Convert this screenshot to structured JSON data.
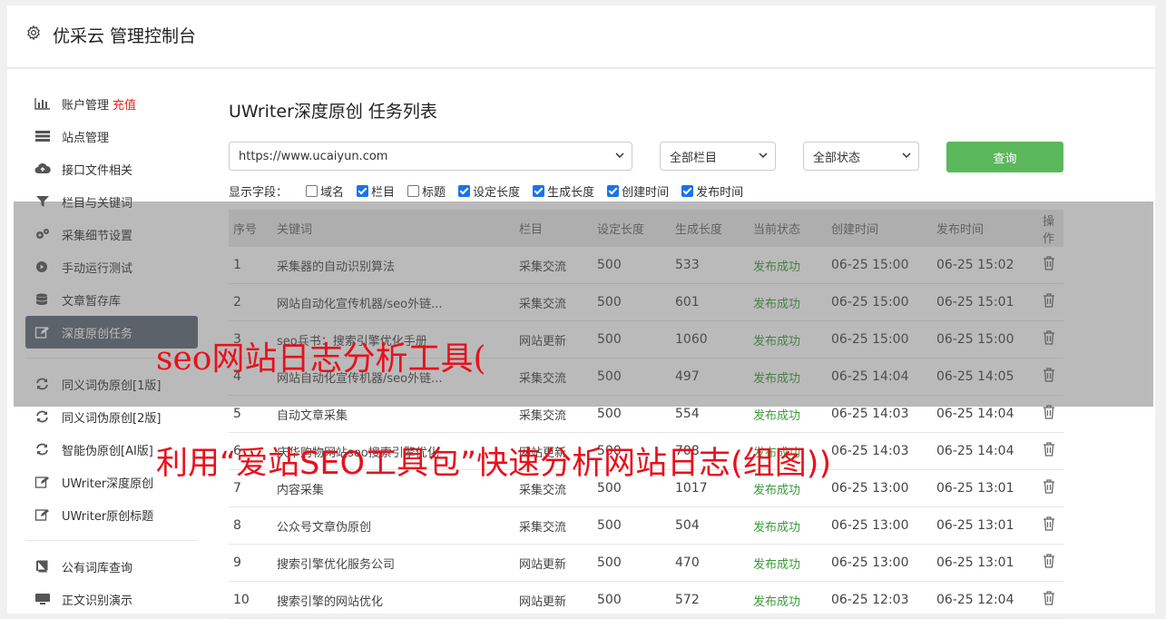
{
  "header": {
    "title": "优采云 管理控制台"
  },
  "sidebar": {
    "items": [
      {
        "label": "账户管理",
        "extra": "充值",
        "icon": "bar-chart-icon"
      },
      {
        "label": "站点管理",
        "icon": "server-icon"
      },
      {
        "label": "接口文件相关",
        "icon": "cloud-upload-icon"
      },
      {
        "label": "栏目与关键词",
        "icon": "filter-icon"
      },
      {
        "label": "采集细节设置",
        "icon": "cogs-icon"
      },
      {
        "label": "手动运行测试",
        "icon": "play-circle-icon"
      },
      {
        "label": "文章暂存库",
        "icon": "database-icon"
      },
      {
        "label": "深度原创任务",
        "icon": "edit-icon"
      },
      {
        "label": "同义词伪原创[1版]",
        "icon": "refresh-icon"
      },
      {
        "label": "同义词伪原创[2版]",
        "icon": "refresh-icon"
      },
      {
        "label": "智能伪原创[AI版]",
        "icon": "refresh-icon"
      },
      {
        "label": "UWriter深度原创",
        "icon": "edit-icon"
      },
      {
        "label": "UWriter原创标题",
        "icon": "edit-icon"
      },
      {
        "label": "公有词库查询",
        "icon": "book-icon"
      },
      {
        "label": "正文识别演示",
        "icon": "monitor-icon"
      }
    ]
  },
  "main": {
    "title": "UWriter深度原创 任务列表",
    "site_select": "https://www.ucaiyun.com",
    "column_select": "全部栏目",
    "status_select": "全部状态",
    "query_label": "查询",
    "fields_label": "显示字段：",
    "fields": [
      {
        "label": "域名",
        "checked": false
      },
      {
        "label": "栏目",
        "checked": true
      },
      {
        "label": "标题",
        "checked": false
      },
      {
        "label": "设定长度",
        "checked": true
      },
      {
        "label": "生成长度",
        "checked": true
      },
      {
        "label": "创建时间",
        "checked": true
      },
      {
        "label": "发布时间",
        "checked": true
      }
    ],
    "table": {
      "headers": [
        "序号",
        "关键词",
        "栏目",
        "设定长度",
        "生成长度",
        "当前状态",
        "创建时间",
        "发布时间",
        "操作"
      ],
      "rows": [
        [
          "1",
          "采集器的自动识别算法",
          "采集交流",
          "500",
          "533",
          "发布成功",
          "06-25 15:00",
          "06-25 15:02"
        ],
        [
          "2",
          "网站自动化宣传机器/seo外链...",
          "采集交流",
          "500",
          "601",
          "发布成功",
          "06-25 15:00",
          "06-25 15:01"
        ],
        [
          "3",
          "seo兵书：搜索引擎优化手册",
          "网站更新",
          "500",
          "1060",
          "发布成功",
          "06-25 15:00",
          "06-25 15:00"
        ],
        [
          "4",
          "网站自动化宣传机器/seo外链...",
          "采集交流",
          "500",
          "497",
          "发布成功",
          "06-25 14:04",
          "06-25 14:05"
        ],
        [
          "5",
          "自动文章采集",
          "采集交流",
          "500",
          "554",
          "发布成功",
          "06-25 14:03",
          "06-25 14:04"
        ],
        [
          "6",
          "庆华购物网站seo搜索引擎优化",
          "网站更新",
          "500",
          "708",
          "发布成功",
          "06-25 14:03",
          "06-25 14:04"
        ],
        [
          "7",
          "内容采集",
          "采集交流",
          "500",
          "1017",
          "发布成功",
          "06-25 13:00",
          "06-25 13:01"
        ],
        [
          "8",
          "公众号文章伪原创",
          "采集交流",
          "500",
          "504",
          "发布成功",
          "06-25 13:00",
          "06-25 13:01"
        ],
        [
          "9",
          "搜索引擎优化服务公司",
          "网站更新",
          "500",
          "470",
          "发布成功",
          "06-25 13:00",
          "06-25 13:01"
        ],
        [
          "10",
          "搜索引擎的网站优化",
          "网站更新",
          "500",
          "572",
          "发布成功",
          "06-25 12:03",
          "06-25 12:04"
        ]
      ]
    }
  },
  "watermark": {
    "line1": "seo网站日志分析工具(",
    "line2": "利用“爱站SEO工具包”快速分析网站日志(组图))"
  },
  "colors": {
    "accent_green": "#5cb85c",
    "status_green": "#3a9a3a",
    "active_nav": "#5d6876",
    "watermark_red": "#e8101c"
  }
}
